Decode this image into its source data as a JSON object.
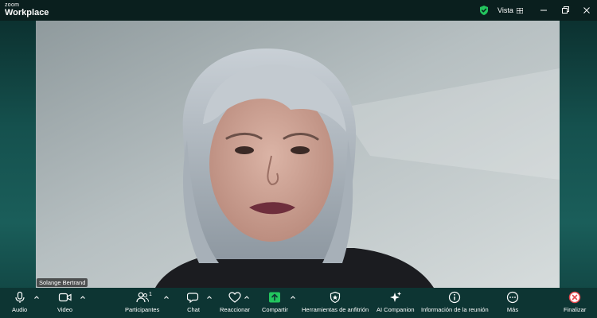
{
  "app": {
    "brand_small": "zoom",
    "brand_large": "Workplace"
  },
  "titlebar": {
    "view_label": "Vista",
    "shield_icon": "green-shield-check-icon",
    "colors": {
      "shield": "#23c55e",
      "bg": "#0a1f1e"
    }
  },
  "video": {
    "participant_name": "Solange Bertrand"
  },
  "toolbar": {
    "audio": "Audio",
    "video": "Video",
    "participants": "Participantes",
    "participants_count": "1",
    "chat": "Chat",
    "react": "Reaccionar",
    "share": "Compartir",
    "host_tools": "Herramientas de anfitrión",
    "ai_companion": "AI Companion",
    "meeting_info": "Información de la reunión",
    "more": "Más",
    "end": "Finalizar",
    "colors": {
      "share": "#22c55e",
      "end": "#e5484d"
    }
  }
}
